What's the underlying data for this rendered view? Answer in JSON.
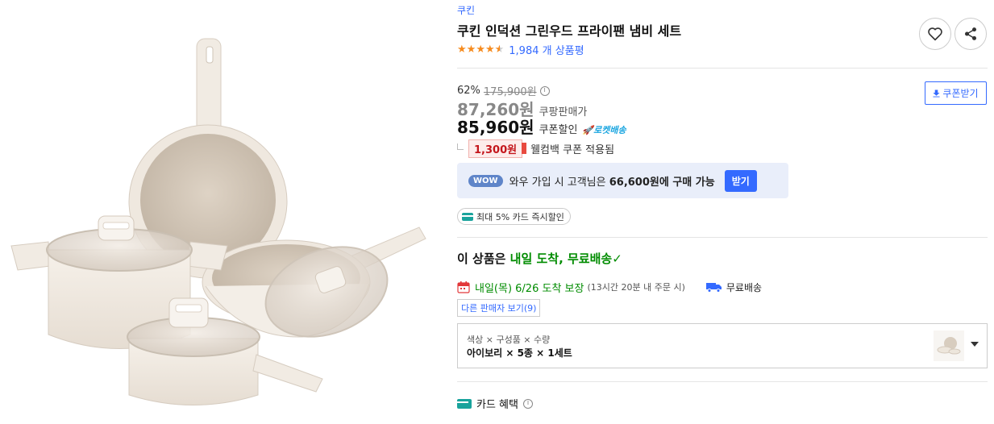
{
  "product": {
    "brand": "쿠킨",
    "title": "쿠킨 인덕션 그린우드 프라이팬 냄비 세트",
    "rating": 4.5,
    "review_count": "1,984 개 상품평"
  },
  "price": {
    "discount_rate": "62%",
    "original_price": "175,900원",
    "sale_price": "87,260원",
    "sale_label": "쿠팡판매가",
    "coupon_price": "85,960원",
    "coupon_label": "쿠폰할인",
    "rocket_label": "로켓배송",
    "coupon_button": "쿠폰받기",
    "welcome_amount": "1,300원",
    "welcome_text": "웰컴백 쿠폰 적용됨"
  },
  "wow": {
    "badge": "WOW",
    "text_prefix": "와우 가입 시 고객님은 ",
    "text_bold": "66,600원에 구매 가능",
    "button": "받기"
  },
  "card_pill": "최대 5% 카드 즉시할인",
  "delivery": {
    "head_prefix": "이 상품은 ",
    "head_green": "내일 도착, 무료배송",
    "check": "✓",
    "arrival": "내일(목) 6/26 도착 보장",
    "arrival_sub": "(13시간 20분 내 주문 시)",
    "free_shipping": "무료배송",
    "other_sellers": "다른 판매자 보기(9)"
  },
  "option": {
    "label": "색상 × 구성품 × 수량",
    "value": "아이보리 × 5종 × 1세트"
  },
  "card_benefit": "카드 혜택",
  "colors": {
    "accent": "#346aff",
    "green": "#008c00",
    "star": "#f68b1e",
    "coupon_red": "#c4161c",
    "wow_bg": "#e9eefa"
  }
}
